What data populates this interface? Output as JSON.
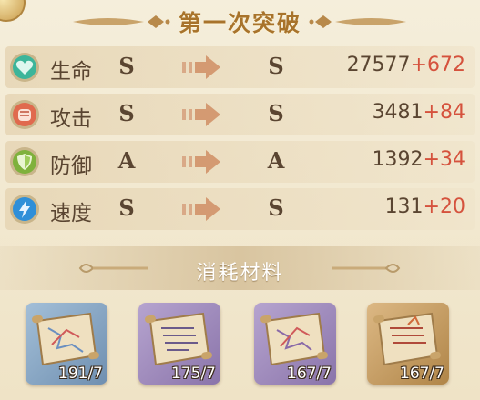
{
  "header": {
    "title": "第一次突破"
  },
  "stats": [
    {
      "icon": "heart-icon",
      "name": "生命",
      "from_grade": "S",
      "to_grade": "S",
      "base": "27577",
      "bonus": "+672",
      "color": "#3cb59a"
    },
    {
      "icon": "fist-icon",
      "name": "攻击",
      "from_grade": "S",
      "to_grade": "S",
      "base": "3481",
      "bonus": "+84",
      "color": "#e06a4e"
    },
    {
      "icon": "shield-icon",
      "name": "防御",
      "from_grade": "A",
      "to_grade": "A",
      "base": "1392",
      "bonus": "+34",
      "color": "#7fb13c"
    },
    {
      "icon": "lightning-icon",
      "name": "速度",
      "from_grade": "S",
      "to_grade": "S",
      "base": "131",
      "bonus": "+20",
      "color": "#2f8fd8"
    }
  ],
  "materials": {
    "title": "消耗材料",
    "items": [
      {
        "icon": "map-scroll-icon",
        "count": "191/7",
        "bg": "#8aa7c4"
      },
      {
        "icon": "map-scroll-icon",
        "count": "175/7",
        "bg": "#9a86b8"
      },
      {
        "icon": "map-scroll-icon",
        "count": "167/7",
        "bg": "#9a86b8"
      },
      {
        "icon": "map-scroll-icon",
        "count": "167/7",
        "bg": "#c49b62"
      }
    ]
  },
  "colors": {
    "accent": "#a8732b",
    "bonus": "#d5523d",
    "text": "#5a4531"
  }
}
